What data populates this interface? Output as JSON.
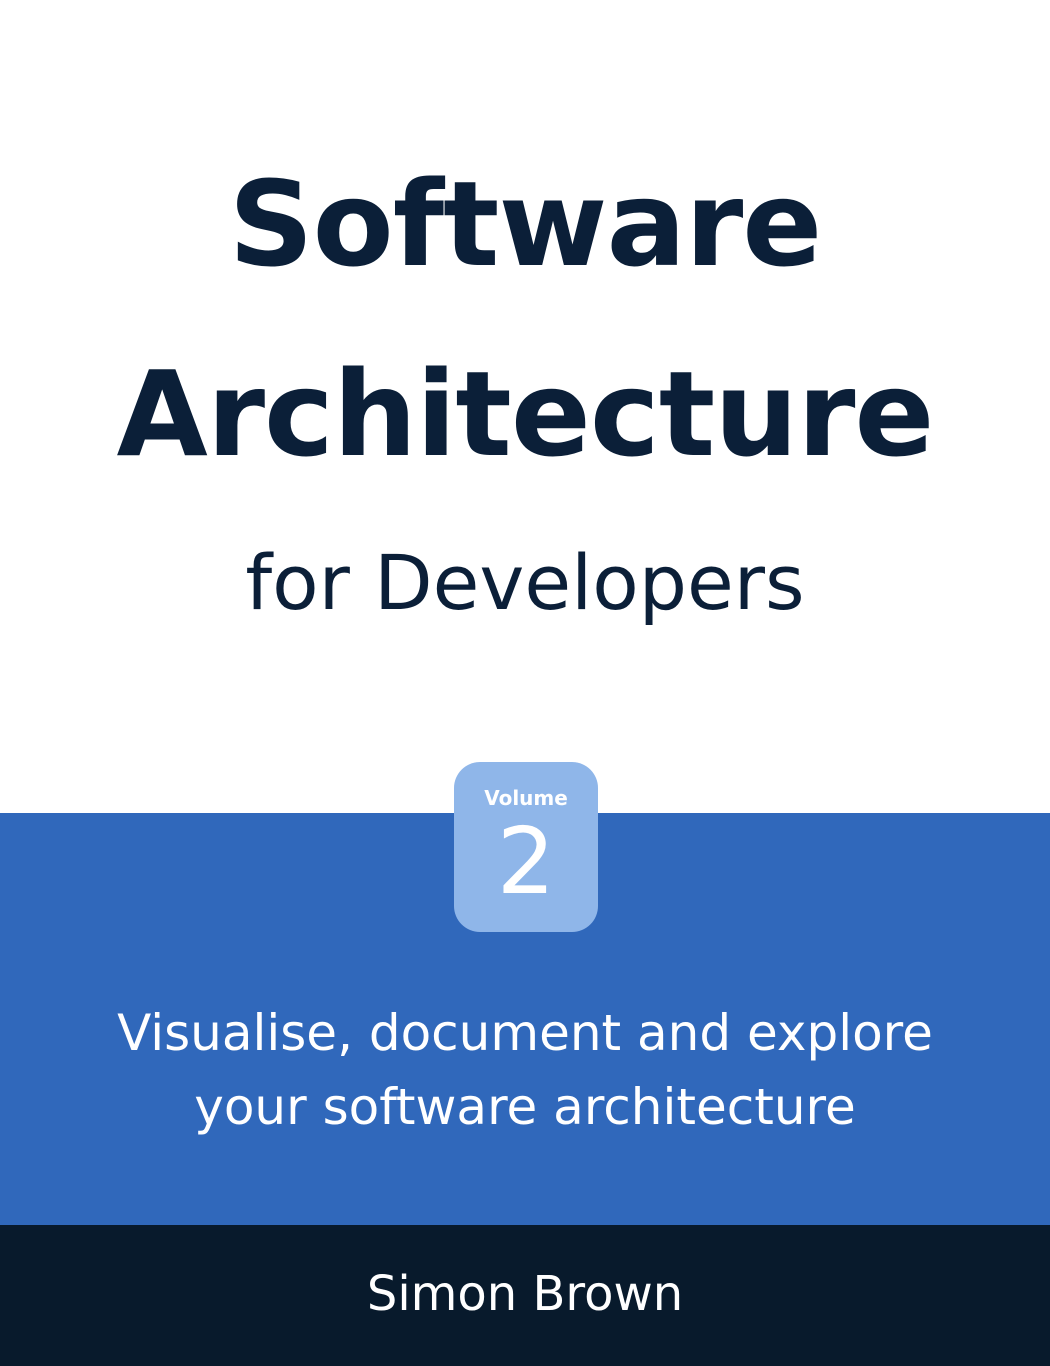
{
  "cover": {
    "title_lines": [
      "Software",
      "Architecture"
    ],
    "subtitle": "for Developers",
    "volume_label": "Volume",
    "volume_number": "2",
    "tagline_lines": [
      "Visualise, document and explore",
      "your software architecture"
    ],
    "author": "Simon Brown"
  },
  "colors": {
    "title_text": "#0b1f38",
    "band_blue": "#3068bb",
    "badge_blue": "#8fb6e9",
    "footer_navy": "#081a2c"
  }
}
